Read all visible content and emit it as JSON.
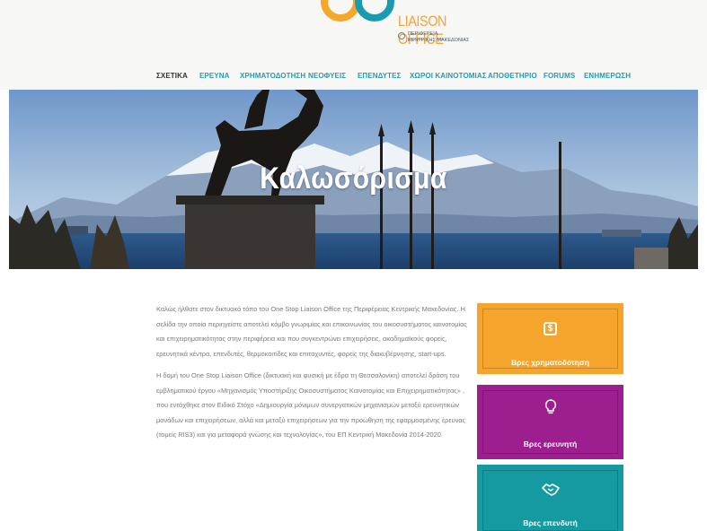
{
  "header": {
    "logo": {
      "title": "LIAISON OFFICE",
      "subtitle_line1": "ΠΕΡΙΦΕΡΕΙΑ",
      "subtitle_line2": "ΚΕΝΤΡΙΚΗΣ ΜΑΚΕΔΟΝΙΑΣ"
    },
    "nav": [
      {
        "label": "ΣΧΕΤΙΚΑ",
        "active": true
      },
      {
        "label": "ΕΡΕΥΝΑ"
      },
      {
        "label": "ΧΡΗΜΑΤΟΔΟΤΗΣΗ"
      },
      {
        "label": "ΝΕΟΦΥΕΙΣ"
      },
      {
        "label": "ΕΠΕΝΔΥΤΕΣ"
      },
      {
        "label": "ΧΩΡΟΙ ΚΑΙΝΟΤΟΜΙΑΣ"
      },
      {
        "label": "ΑΠΟΘΕΤΗΡΙΟ"
      },
      {
        "label": "FORUMS"
      },
      {
        "label": "ΕΝΗΜΕΡΩΣΗ"
      }
    ]
  },
  "hero": {
    "title": "Καλωσόρισμα"
  },
  "content": {
    "paragraph_1": "Καλώς ήλθατε στον δικτυακό τόπο του One Stop Liaison Office της Περιφέρειας Κεντρικής Μακεδονίας. Η σελίδα την οποία περιηγείστε αποτελεί κόμβο γνωριμίας και επικοινωνίας του οικοσυστήματος καινοτομίας και επιχειρηματικότητας στην περιφέρεια και που συγκεντρώνει επιχειρήσεις, ακαδημαϊκούς φορείς, ερευνητικά κέντρα, επενδυτές, θερμοκοιτίδες και επιταχυντές, φορείς της διακυβέρνησης, start-ups.",
    "paragraph_2": "Η δομή του One Stop Liaison Office (δικτυακή και φυσική με έδρα τη Θεσσαλονίκη) αποτελεί δράση του εμβληματικού έργου «Μηχανισμός Υποστήριξης Οικοσυστήματος Καινοτομίας και Επιχειρηματικότητας» , που εντάχθηκε στον Ειδικό Στόχο «Δημιουργία μόνιμων συνεργατικών μηχανισμών μεταξύ ερευνητικών μονάδων και επιχειρήσεων, αλλά και μεταξύ επιχειρήσεων για την προώθηση της εφαρμοσμένης έρευνας (τομείς RIS3) και για μεταφορά γνώσης και τεχνολογίας», του ΕΠ Κεντρική Μακεδονία 2014-2020."
  },
  "cta": {
    "funding": {
      "label": "Βρες χρηματοδότηση",
      "icon": "money-icon",
      "color": "#f5a42c"
    },
    "research": {
      "label": "Βρες ερευνητή",
      "icon": "lightbulb-icon",
      "color": "#9c1e8f"
    },
    "investor": {
      "label": "Βρες επενδυτή",
      "icon": "handshake-icon",
      "color": "#159aa2"
    }
  },
  "colors": {
    "nav_link": "#2b9aa9",
    "nav_active": "#333333",
    "logo_orange": "#f4a72a",
    "logo_teal": "#1a9bb0"
  }
}
